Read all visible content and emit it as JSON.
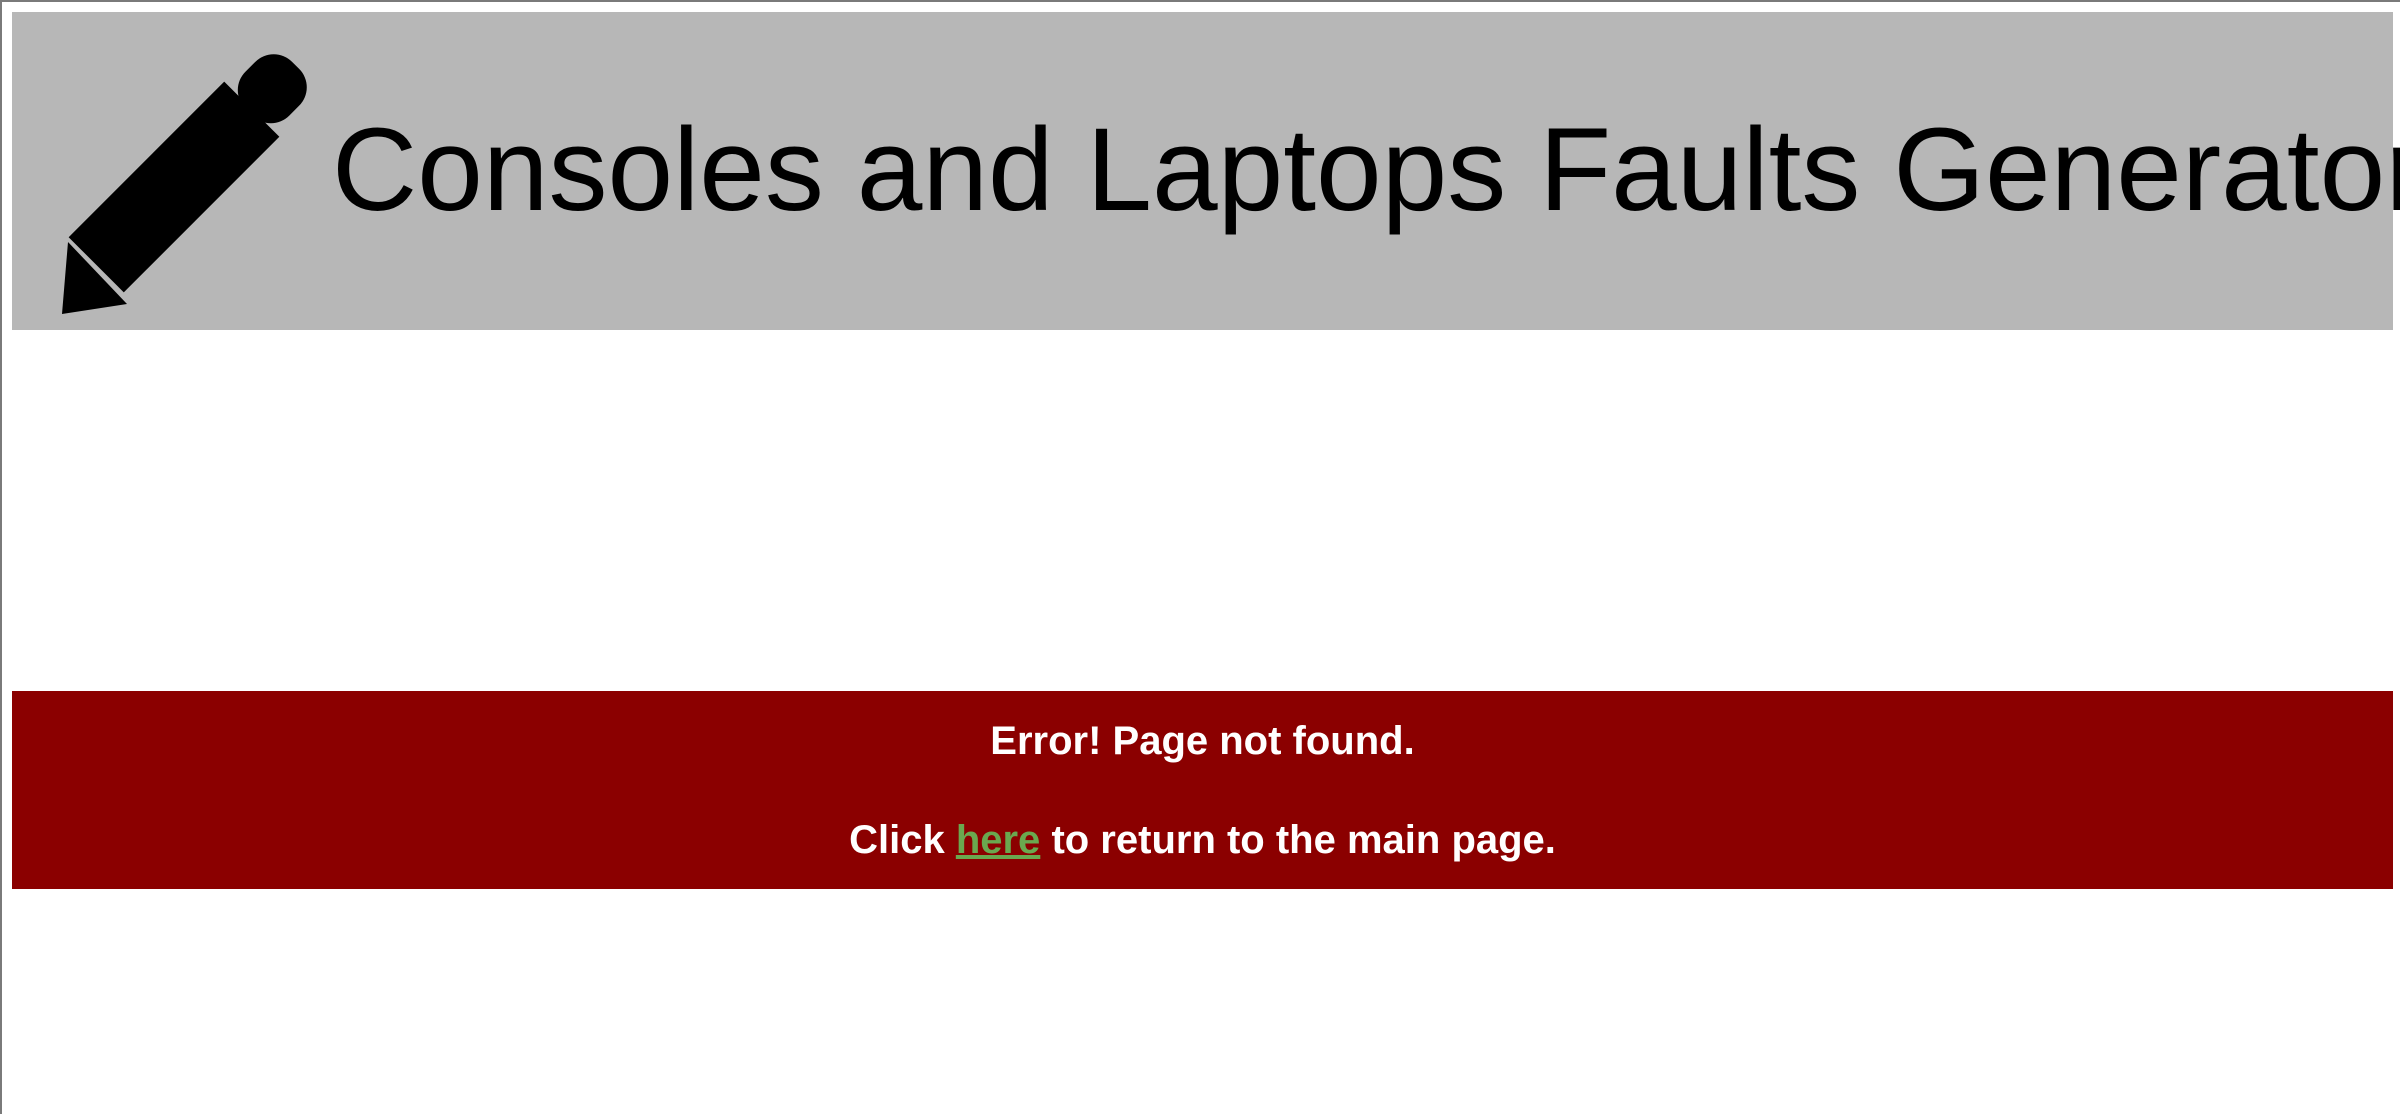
{
  "header": {
    "title": "Consoles and Laptops Faults Generator",
    "icon": "pencil-icon",
    "background_color": "#b7b7b7"
  },
  "error": {
    "message": "Error! Page not found.",
    "prefix": "Click",
    "link_label": "here",
    "suffix": "to return to the main page.",
    "background_color": "#8b0000",
    "link_color": "#6aa84f"
  }
}
